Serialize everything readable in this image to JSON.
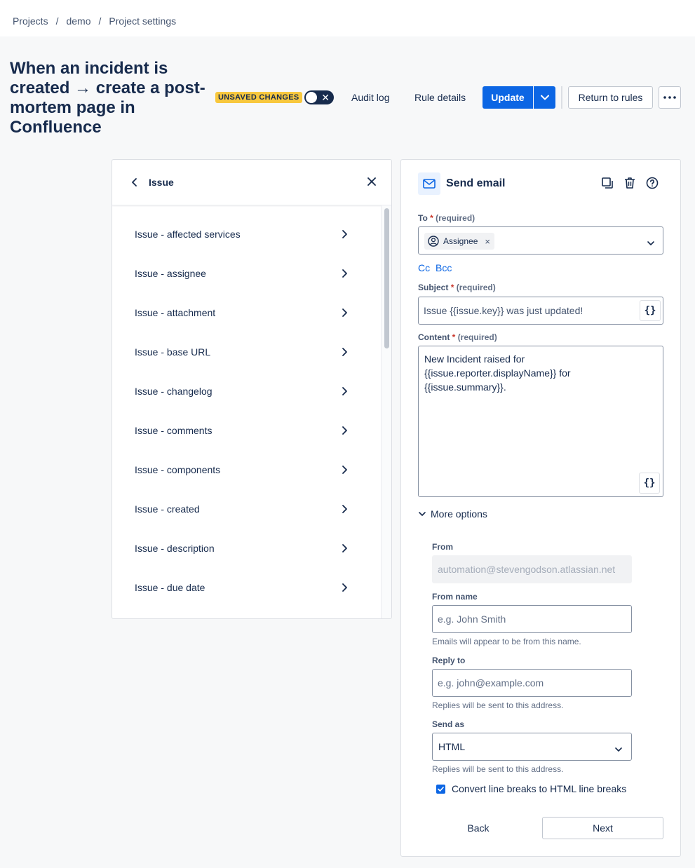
{
  "breadcrumb": {
    "items": [
      "Projects",
      "demo",
      "Project settings"
    ],
    "separator": "/"
  },
  "page": {
    "title": "When an incident is created → create a post-mortem page in Confluence"
  },
  "header": {
    "status_badge": "UNSAVED CHANGES",
    "audit_log": "Audit log",
    "rule_details": "Rule details",
    "update": "Update",
    "return_to_rules": "Return to rules",
    "more_icon": "ellipsis-icon"
  },
  "left_panel": {
    "title": "Issue",
    "items": [
      "Issue - affected services",
      "Issue - assignee",
      "Issue - attachment",
      "Issue - base URL",
      "Issue - changelog",
      "Issue - comments",
      "Issue - components",
      "Issue - created",
      "Issue - description",
      "Issue - due date"
    ]
  },
  "action": {
    "title": "Send email",
    "to": {
      "label": "To",
      "required_mark": "*",
      "hint": "(required)",
      "chip": "Assignee",
      "chip_remove": "×"
    },
    "cc": "Cc",
    "bcc": "Bcc",
    "subject": {
      "label": "Subject",
      "required_mark": "*",
      "hint": "(required)",
      "value": "Issue {{issue.key}} was just updated!"
    },
    "content": {
      "label": "Content",
      "required_mark": "*",
      "hint": "(required)",
      "value": "New Incident raised for\n{{issue.reporter.displayName}} for\n{{issue.summary}}."
    },
    "smart_value_button": "{}",
    "more_options": "More options",
    "from": {
      "label": "From",
      "value": "automation@stevengodson.atlassian.net"
    },
    "from_name": {
      "label": "From name",
      "placeholder": "e.g. John Smith",
      "helper": "Emails will appear to be from this name."
    },
    "reply_to": {
      "label": "Reply to",
      "placeholder": "e.g. john@example.com",
      "helper": "Replies will be sent to this address."
    },
    "send_as": {
      "label": "Send as",
      "value": "HTML",
      "helper": "Replies will be sent to this address."
    },
    "convert_line_breaks": {
      "label": "Convert line breaks to HTML line breaks",
      "checked": true
    },
    "back": "Back",
    "next": "Next"
  },
  "colors": {
    "primary": "#0c66e4",
    "badge": "#f8c83e",
    "required": "#c9372c"
  }
}
